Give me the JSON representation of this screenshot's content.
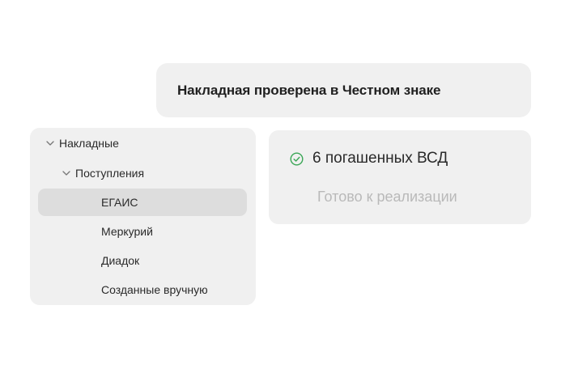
{
  "banner": {
    "text": "Накладная проверена в Честном знаке"
  },
  "tree": {
    "root_label": "Накладные",
    "group_label": "Поступления",
    "items": [
      {
        "label": "ЕГАИС",
        "selected": true
      },
      {
        "label": "Меркурий",
        "selected": false
      },
      {
        "label": "Диадок",
        "selected": false
      },
      {
        "label": "Созданные вручную",
        "selected": false
      }
    ],
    "chevron_icon": "chevron-down-icon"
  },
  "status": {
    "icon": "check-circle-icon",
    "icon_color": "#3aa655",
    "title": "6 погашенных ВСД",
    "subtitle": "Готово к реализации"
  }
}
